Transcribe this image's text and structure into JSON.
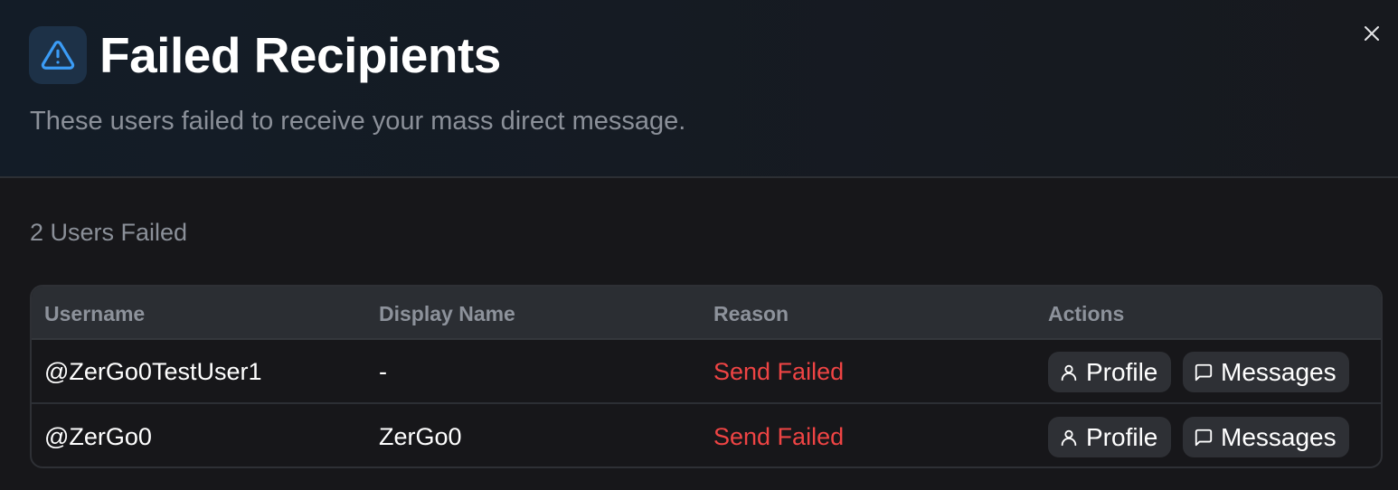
{
  "dialog": {
    "title": "Failed Recipients",
    "subtitle": "These users failed to receive your mass direct message.",
    "title_icon": "warning-triangle-icon",
    "close_icon": "close-icon"
  },
  "summary": {
    "count_text": "2 Users Failed"
  },
  "table": {
    "columns": [
      "Username",
      "Display Name",
      "Reason",
      "Actions"
    ],
    "rows": [
      {
        "username": "@ZerGo0TestUser1",
        "display_name": "-",
        "reason": "Send Failed",
        "profile_label": "Profile",
        "messages_label": "Messages"
      },
      {
        "username": "@ZerGo0",
        "display_name": "ZerGo0",
        "reason": "Send Failed",
        "profile_label": "Profile",
        "messages_label": "Messages"
      }
    ]
  },
  "colors": {
    "accent_icon": "#3b9cf6",
    "error": "#ef4444",
    "muted_text": "#8b9099"
  }
}
